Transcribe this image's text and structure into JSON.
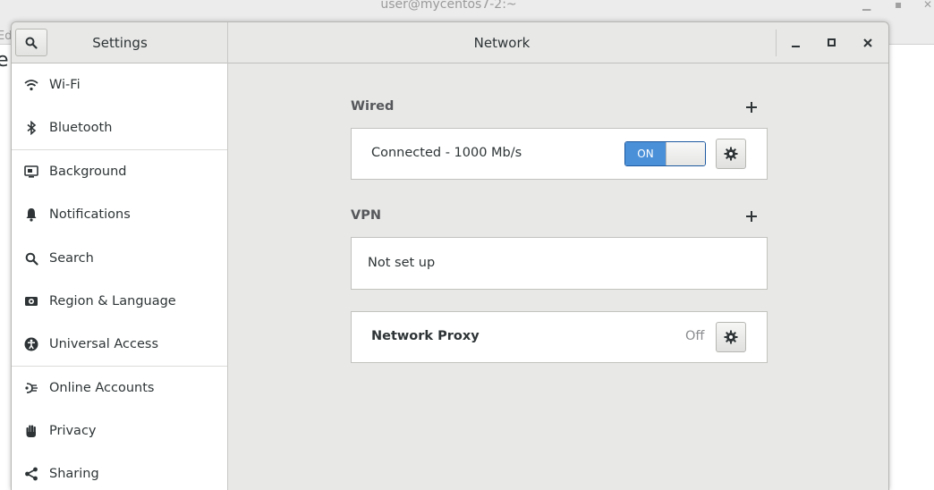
{
  "background_window": {
    "title": "user@mycentos7-2:~",
    "menu_fragment": "Ed",
    "text_fragment": "e"
  },
  "header": {
    "sidebar_title": "Settings",
    "page_title": "Network"
  },
  "sidebar": {
    "items": [
      {
        "label": "Wi-Fi",
        "icon": "wifi-icon"
      },
      {
        "label": "Bluetooth",
        "icon": "bluetooth-icon"
      },
      {
        "label": "Background",
        "icon": "background-icon"
      },
      {
        "label": "Notifications",
        "icon": "bell-icon"
      },
      {
        "label": "Search",
        "icon": "search-icon"
      },
      {
        "label": "Region & Language",
        "icon": "region-icon"
      },
      {
        "label": "Universal Access",
        "icon": "accessibility-icon"
      },
      {
        "label": "Online Accounts",
        "icon": "online-accounts-icon"
      },
      {
        "label": "Privacy",
        "icon": "hand-icon"
      },
      {
        "label": "Sharing",
        "icon": "share-icon"
      }
    ]
  },
  "wired": {
    "section_label": "Wired",
    "status": "Connected - 1000 Mb/s",
    "toggle_label": "ON"
  },
  "vpn": {
    "section_label": "VPN",
    "status": "Not set up"
  },
  "proxy": {
    "label": "Network Proxy",
    "value": "Off"
  },
  "colors": {
    "accent": "#4a90d9",
    "window_bg": "#e8e8e7",
    "sidebar_bg": "#ffffff"
  }
}
